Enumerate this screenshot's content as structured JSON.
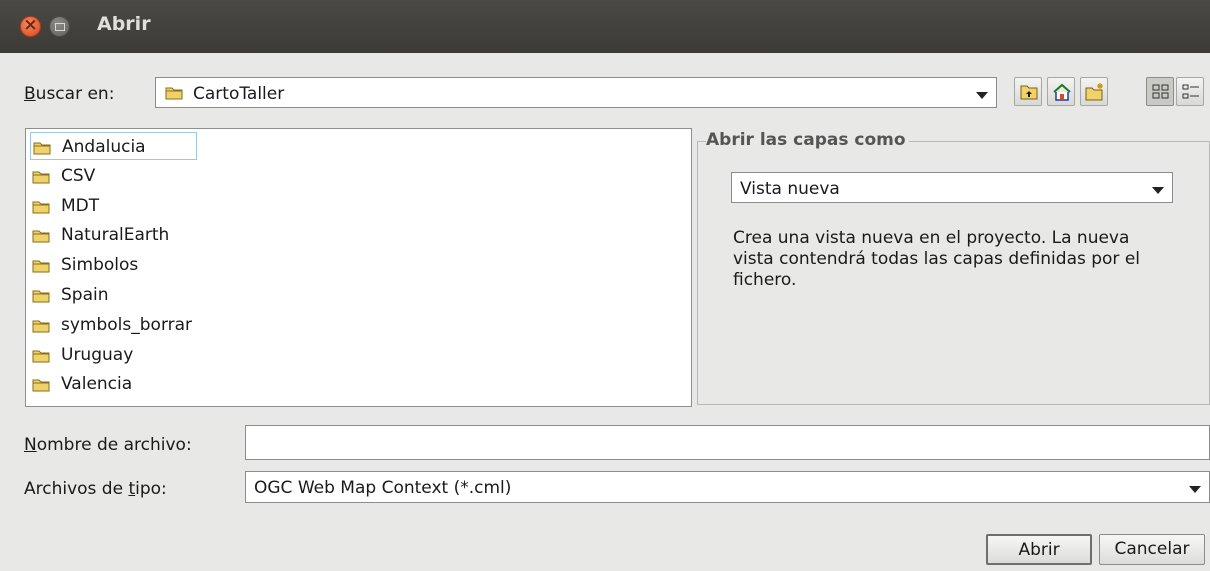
{
  "window": {
    "title": "Abrir"
  },
  "lookin": {
    "label_u": "B",
    "label_rest": "uscar en:",
    "value": "CartoTaller"
  },
  "toolbar": {
    "buttons": [
      "up-folder-icon",
      "home-icon",
      "new-folder-icon",
      "list-view-icon",
      "details-view-icon"
    ]
  },
  "files": [
    {
      "name": "Andalucia"
    },
    {
      "name": "CSV"
    },
    {
      "name": "MDT"
    },
    {
      "name": "NaturalEarth"
    },
    {
      "name": "Simbolos"
    },
    {
      "name": "Spain"
    },
    {
      "name": "symbols_borrar"
    },
    {
      "name": "Uruguay"
    },
    {
      "name": "Valencia"
    }
  ],
  "options": {
    "title": "Abrir las capas como",
    "mode": "Vista nueva",
    "description": "Crea una vista nueva en el proyecto. La nueva vista contendrá todas las capas definidas por el fichero."
  },
  "filename": {
    "label_u": "N",
    "label_rest": "ombre de archivo:",
    "value": ""
  },
  "filetype": {
    "label_pre": "Archivos de ",
    "label_u": "t",
    "label_rest": "ipo:",
    "value": "OGC Web Map Context (*.cml)"
  },
  "actions": {
    "open": "Abrir",
    "cancel": "Cancelar"
  },
  "colors": {
    "titlebar": "#3c3b37",
    "background": "#e8e8e7",
    "folder": "#e8c34a"
  }
}
